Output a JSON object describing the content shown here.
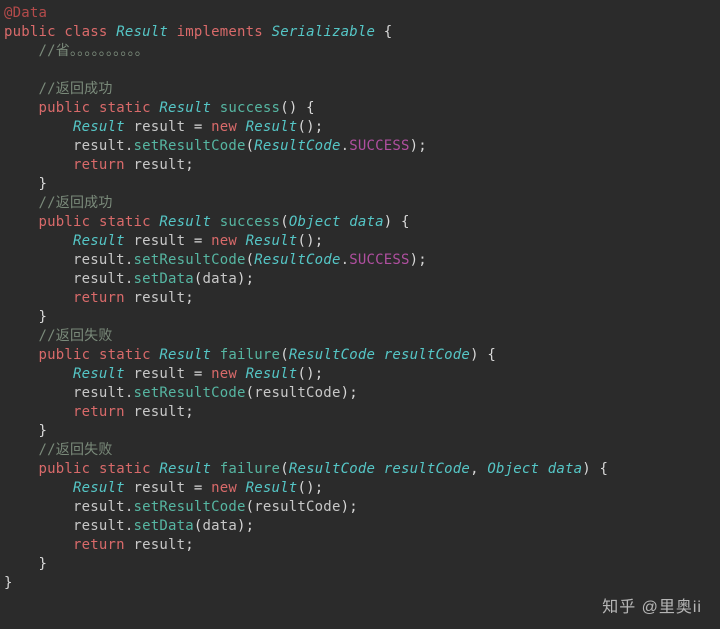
{
  "annotation": "@Data",
  "class_decl": {
    "kw_public": "public",
    "kw_class": "class",
    "name": "Result",
    "kw_implements": "implements",
    "iface": "Serializable",
    "brace_open": "{"
  },
  "omit_comment": "//省。。。。。。。。。。",
  "methods": [
    {
      "comment": "//返回成功",
      "kw_public": "public",
      "kw_static": "static",
      "ret_type": "Result",
      "name": "success",
      "params_raw": "",
      "body": [
        {
          "kind": "new",
          "type": "Result",
          "var": "result",
          "ctor_type": "Result"
        },
        {
          "kind": "call",
          "target": "result",
          "method": "setResultCode",
          "arg_type": "ResultCode",
          "arg_const": "SUCCESS"
        },
        {
          "kind": "return",
          "var": "result"
        }
      ]
    },
    {
      "comment": "//返回成功",
      "kw_public": "public",
      "kw_static": "static",
      "ret_type": "Result",
      "name": "success",
      "params": [
        {
          "type": "Object",
          "name": "data"
        }
      ],
      "body": [
        {
          "kind": "new",
          "type": "Result",
          "var": "result",
          "ctor_type": "Result"
        },
        {
          "kind": "call",
          "target": "result",
          "method": "setResultCode",
          "arg_type": "ResultCode",
          "arg_const": "SUCCESS"
        },
        {
          "kind": "call",
          "target": "result",
          "method": "setData",
          "arg_ident": "data"
        },
        {
          "kind": "return",
          "var": "result"
        }
      ]
    },
    {
      "comment": "//返回失败",
      "kw_public": "public",
      "kw_static": "static",
      "ret_type": "Result",
      "name": "failure",
      "params": [
        {
          "type": "ResultCode",
          "name": "resultCode"
        }
      ],
      "body": [
        {
          "kind": "new",
          "type": "Result",
          "var": "result",
          "ctor_type": "Result"
        },
        {
          "kind": "call",
          "target": "result",
          "method": "setResultCode",
          "arg_ident": "resultCode"
        },
        {
          "kind": "return",
          "var": "result"
        }
      ]
    },
    {
      "comment": "//返回失败",
      "kw_public": "public",
      "kw_static": "static",
      "ret_type": "Result",
      "name": "failure",
      "params": [
        {
          "type": "ResultCode",
          "name": "resultCode"
        },
        {
          "type": "Object",
          "name": "data"
        }
      ],
      "body": [
        {
          "kind": "new",
          "type": "Result",
          "var": "result",
          "ctor_type": "Result"
        },
        {
          "kind": "call",
          "target": "result",
          "method": "setResultCode",
          "arg_ident": "resultCode"
        },
        {
          "kind": "call",
          "target": "result",
          "method": "setData",
          "arg_ident": "data"
        },
        {
          "kind": "return",
          "var": "result"
        }
      ]
    }
  ],
  "class_close": "}",
  "watermark": "知乎 @里奥ii",
  "tokens": {
    "kw_new": "new",
    "kw_return": "return",
    "eq": " = ",
    "semi": ";",
    "paren_open": "(",
    "paren_close": ")",
    "brace_open": "{",
    "brace_close": "}",
    "dot": ".",
    "comma": ", "
  }
}
